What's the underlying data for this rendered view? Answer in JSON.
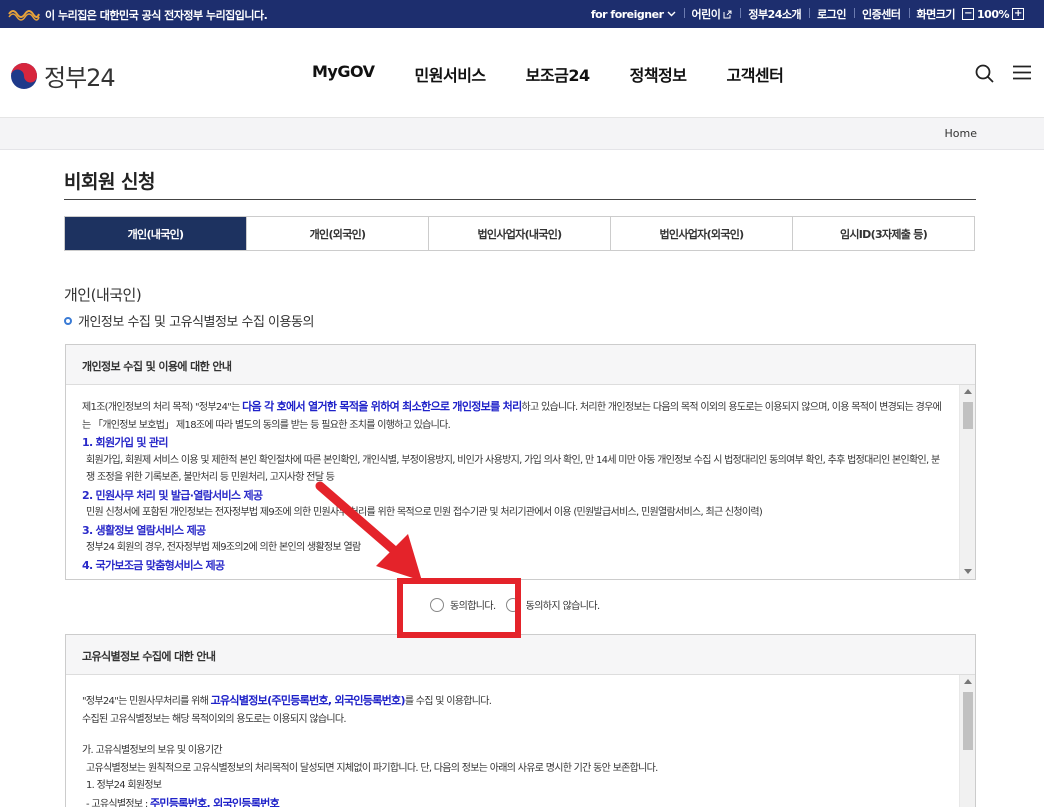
{
  "topbar": {
    "notice": "이 누리집은 대한민국 공식 전자정부 누리집입니다.",
    "links": [
      {
        "label": "for foreigner"
      },
      {
        "label": "어린이"
      },
      {
        "label": "정부24소개"
      },
      {
        "label": "로그인"
      },
      {
        "label": "인증센터"
      },
      {
        "label": "화면크기"
      }
    ],
    "zoom_minus": "−",
    "zoom_value": "100%",
    "zoom_plus": "+",
    "accent": "#1d2e6e"
  },
  "header": {
    "logo_text": "정부24",
    "nav": [
      "MyGOV",
      "민원서비스",
      "보조금24",
      "정책정보",
      "고객센터"
    ]
  },
  "breadcrumb": {
    "home": "Home"
  },
  "page": {
    "title": "비회원 신청",
    "tabs": [
      {
        "label": "개인(내국인)",
        "active": true
      },
      {
        "label": "개인(외국인)"
      },
      {
        "label": "법인사업자(내국인)"
      },
      {
        "label": "법인사업자(외국인)"
      },
      {
        "label": "임시ID(3자제출 등)"
      }
    ],
    "section": "개인(내국인)",
    "subsection": "개인정보 수집 및 고유식별정보 수집 이용동의"
  },
  "privacy_box": {
    "heading": "개인정보 수집 및 이용에 대한 안내",
    "p1_a": "제1조(개인정보의 처리 목적) \"정부24\"는 ",
    "p1_hl": "다음 각 호에서 열거한 목적을 위하여 최소한으로 개인정보를 처리",
    "p1_b": "하고 있습니다. 처리한 개인정보는 다음의 목적 이외의 용도로는 이용되지 않으며, 이용 목적이 변경되는 경우에는 「개인정보 보호법」 제18조에 따라 별도의 동의를 받는 등 필요한 조치를 이행하고 있습니다.",
    "s1_title": "1. 회원가입 및 관리",
    "s1_body": "회원가입, 회원제 서비스 이용 및 제한적 본인 확인절차에 따른 본인확인, 개인식별, 부정이용방지, 비인가 사용방지, 가입 의사 확인, 만 14세 미만 아동 개인정보 수집 시 법정대리인 동의여부 확인, 추후 법정대리인 본인확인, 분쟁 조정을 위한 기록보존, 불만처리 등 민원처리, 고지사항 전달 등",
    "s2_title": "2. 민원사무 처리 및 발급·열람서비스 제공",
    "s2_body": "민원 신청서에 포함된 개인정보는 전자정부법 제9조에 의한 민원사무 처리를 위한 목적으로 민원 접수기관 및 처리기관에서 이용 (민원발급서비스, 민원열람서비스, 최근 신청이력)",
    "s3_title": "3. 생활정보 열람서비스 제공",
    "s3_body": "정부24 회원의 경우, 전자정부법 제9조의2에 의한 본인의 생활정보 열람",
    "s4_title": "4. 국가보조금 맞춤형서비스 제공"
  },
  "consent": {
    "agree": "동의합니다.",
    "disagree": "동의하지 않습니다."
  },
  "unique_box": {
    "heading": "고유식별정보 수집에 대한 안내",
    "p1_a": "\"정부24\"는 민원사무처리를 위해 ",
    "p1_hl": "고유식별정보(주민등록번호, 외국인등록번호)",
    "p1_b": "를 수집 및 이용합니다.",
    "p2": "수집된 고유식별정보는 해당 목적이외의 용도로는 이용되지 않습니다.",
    "p3": "가. 고유식별정보의 보유 및 이용기간",
    "p4": "고유식별정보는 원칙적으로 고유식별정보의 처리목적이 달성되면 지체없이 파기합니다. 단, 다음의 정보는 아래의 사유로 명시한 기간 동안 보존합니다.",
    "p5": "1. 정부24 회원정보",
    "p6_a": "- 고유식별정보 : ",
    "p6_hl": "주민등록번호, 외국인등록번호"
  }
}
